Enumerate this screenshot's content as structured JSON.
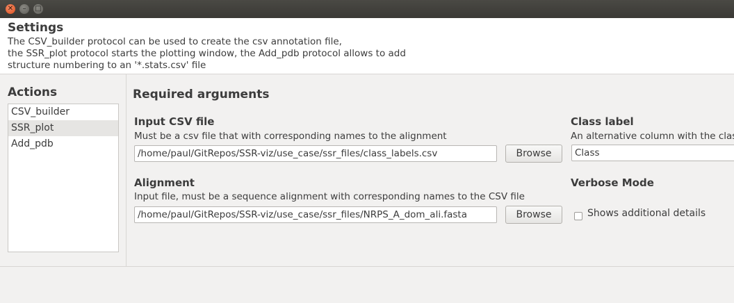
{
  "window": {
    "close_glyph": "✕",
    "min_glyph": "–",
    "max_glyph": "□"
  },
  "header": {
    "title": "Settings",
    "desc_lines": [
      "The CSV_builder protocol can be used to create the csv annotation file,",
      "the SSR_plot protocol starts the plotting window, the Add_pdb protocol allows to add",
      "structure numbering to an '*.stats.csv' file"
    ]
  },
  "actions": {
    "title": "Actions",
    "items": [
      "CSV_builder",
      "SSR_plot",
      "Add_pdb"
    ],
    "selected": "SSR_plot"
  },
  "main": {
    "section_title": "Required arguments",
    "input_csv": {
      "label": "Input CSV file",
      "desc": "Must be a csv file that with corresponding names to the alignment",
      "value": "/home/paul/GitRepos/SSR-viz/use_case/ssr_files/class_labels.csv",
      "button": "Browse"
    },
    "alignment": {
      "label": "Alignment",
      "desc": "Input file, must be a sequence alignment with corresponding names to the CSV file",
      "value": "/home/paul/GitRepos/SSR-viz/use_case/ssr_files/NRPS_A_dom_ali.fasta",
      "button": "Browse"
    },
    "class_label": {
      "label": "Class label",
      "desc": "An alternative column with the clas",
      "value": "Class"
    },
    "verbose": {
      "label": "Verbose Mode",
      "checkbox_label": "Shows additional details",
      "checked": false
    }
  }
}
